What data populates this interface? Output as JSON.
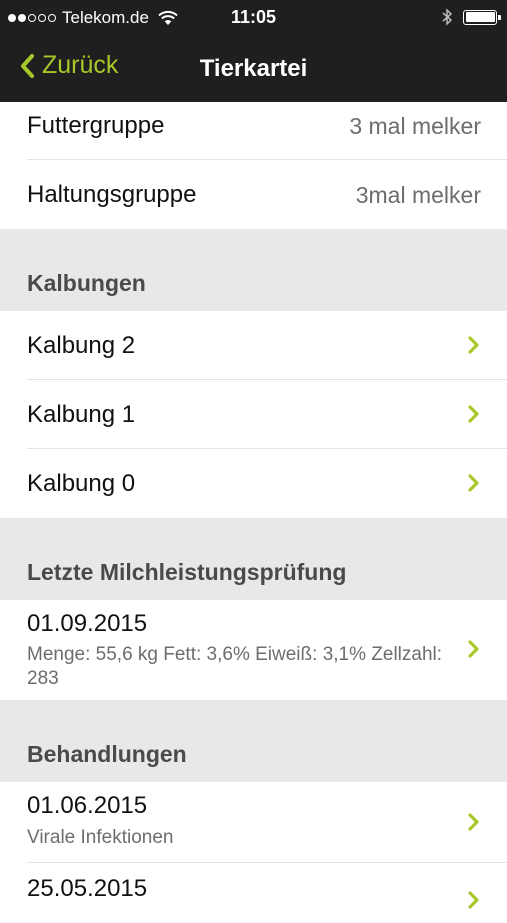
{
  "status_bar": {
    "carrier": "Telekom.de",
    "time": "11:05",
    "signal_bars": [
      1,
      1,
      0,
      0,
      0
    ],
    "battery_level": 1.0
  },
  "nav": {
    "back_label": "Zurück",
    "title": "Tierkartei"
  },
  "details": [
    {
      "label": "Futtergruppe",
      "value": "3 mal melker"
    },
    {
      "label": "Haltungsgruppe",
      "value": "3mal melker"
    }
  ],
  "sections": {
    "kalbungen": {
      "title": "Kalbungen",
      "items": [
        "Kalbung 2",
        "Kalbung 1",
        "Kalbung 0"
      ]
    },
    "milch": {
      "title": "Letzte Milchleistungsprüfung",
      "date": "01.09.2015",
      "details": "Menge: 55,6 kg Fett: 3,6% Eiweiß: 3,1% Zellzahl: 283"
    },
    "behandlungen": {
      "title": "Behandlungen",
      "items": [
        {
          "date": "01.06.2015",
          "description": "Virale Infektionen"
        },
        {
          "date": "25.05.2015",
          "description": ""
        }
      ]
    }
  },
  "colors": {
    "accent": "#a7c829",
    "bar": "#1f1f1f",
    "section_bg": "#e8e8e8"
  },
  "icons": [
    "wifi-icon",
    "bluetooth-icon",
    "battery-icon",
    "back-chevron-icon",
    "chevron-right-icon"
  ]
}
